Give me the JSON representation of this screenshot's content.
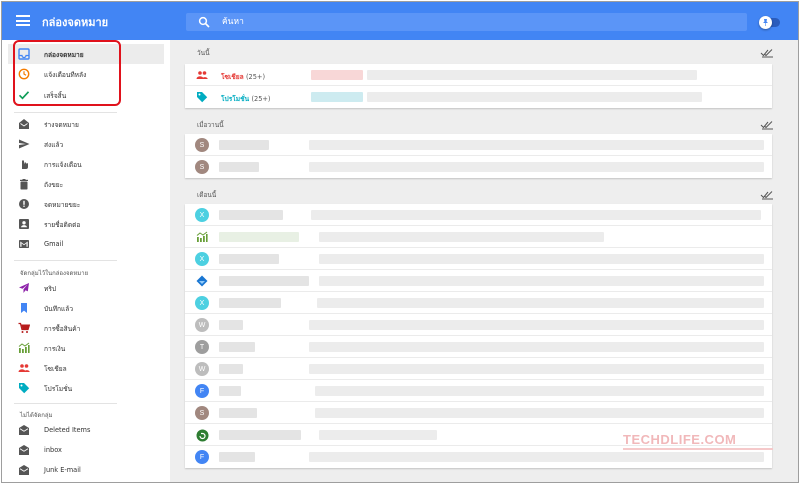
{
  "topbar": {
    "app_title": "กล่องจดหมาย",
    "search_placeholder": "ค้นหา"
  },
  "sidebar": {
    "primary": [
      {
        "label": "กล่องจดหมาย",
        "icon": "inbox-icon",
        "color": "#4285f4",
        "active": true
      },
      {
        "label": "แจ้งเตือนทีหลัง",
        "icon": "clock-icon",
        "color": "#f57c00"
      },
      {
        "label": "เสร็จสิ้น",
        "icon": "check-icon",
        "color": "#0f9d58"
      }
    ],
    "secondary": [
      {
        "label": "ร่างจดหมาย",
        "icon": "drafts-icon"
      },
      {
        "label": "ส่งแล้ว",
        "icon": "send-icon"
      },
      {
        "label": "การแจ้งเตือน",
        "icon": "reminder-icon"
      },
      {
        "label": "ถังขยะ",
        "icon": "trash-icon"
      },
      {
        "label": "จดหมายขยะ",
        "icon": "spam-icon"
      },
      {
        "label": "รายชื่อติดต่อ",
        "icon": "contacts-icon"
      },
      {
        "label": "Gmail",
        "icon": "gmail-icon"
      }
    ],
    "bundles_heading": "จัดกลุ่มไว้ในกล่องจดหมาย",
    "bundles": [
      {
        "label": "ทริป",
        "icon": "plane-icon",
        "color": "#8e24aa"
      },
      {
        "label": "บันทึกแล้ว",
        "icon": "bookmark-icon",
        "color": "#4285f4"
      },
      {
        "label": "การซื้อสินค้า",
        "icon": "cart-icon",
        "color": "#b71c1c"
      },
      {
        "label": "การเงิน",
        "icon": "finance-icon",
        "color": "#689f38"
      },
      {
        "label": "โซเชียล",
        "icon": "people-icon",
        "color": "#e53935"
      },
      {
        "label": "โปรโมชั่น",
        "icon": "tag-icon",
        "color": "#00acc1"
      }
    ],
    "unbundled_heading": "ไม่ได้จัดกลุ่ม",
    "folders": [
      {
        "label": "Deleted Items",
        "icon": "folder-mail-icon"
      },
      {
        "label": "inbox",
        "icon": "folder-mail-icon"
      },
      {
        "label": "Junk E-mail",
        "icon": "folder-mail-icon"
      }
    ]
  },
  "main": {
    "today": {
      "heading": "วันนี้",
      "bundles": [
        {
          "name": "โซเชียล",
          "count": "(25+)",
          "color": "#e53935",
          "icon": "people-icon"
        },
        {
          "name": "โปรโมชั่น",
          "count": "(25+)",
          "color": "#00acc1",
          "icon": "tag-icon"
        }
      ]
    },
    "yesterday": {
      "heading": "เมื่อวานนี้",
      "rows": [
        {
          "avatar": "S",
          "color": "#a1887f"
        },
        {
          "avatar": "S",
          "color": "#a1887f"
        }
      ]
    },
    "this_month": {
      "heading": "เดือนนี้",
      "rows": [
        {
          "avatar": "X",
          "color": "#4dd0e1"
        },
        {
          "icon": "finance-icon"
        },
        {
          "avatar": "X",
          "color": "#4dd0e1"
        },
        {
          "icon": "diamond-icon"
        },
        {
          "avatar": "X",
          "color": "#4dd0e1"
        },
        {
          "avatar": "W",
          "color": "#bdbdbd"
        },
        {
          "avatar": "T",
          "color": "#9e9e9e"
        },
        {
          "avatar": "W",
          "color": "#bdbdbd"
        },
        {
          "avatar": "F",
          "color": "#4285f4"
        },
        {
          "avatar": "S",
          "color": "#a1887f"
        },
        {
          "icon": "green-logo-icon"
        },
        {
          "avatar": "F",
          "color": "#4285f4"
        }
      ]
    }
  },
  "watermark": "TECHDLIFE.COM"
}
